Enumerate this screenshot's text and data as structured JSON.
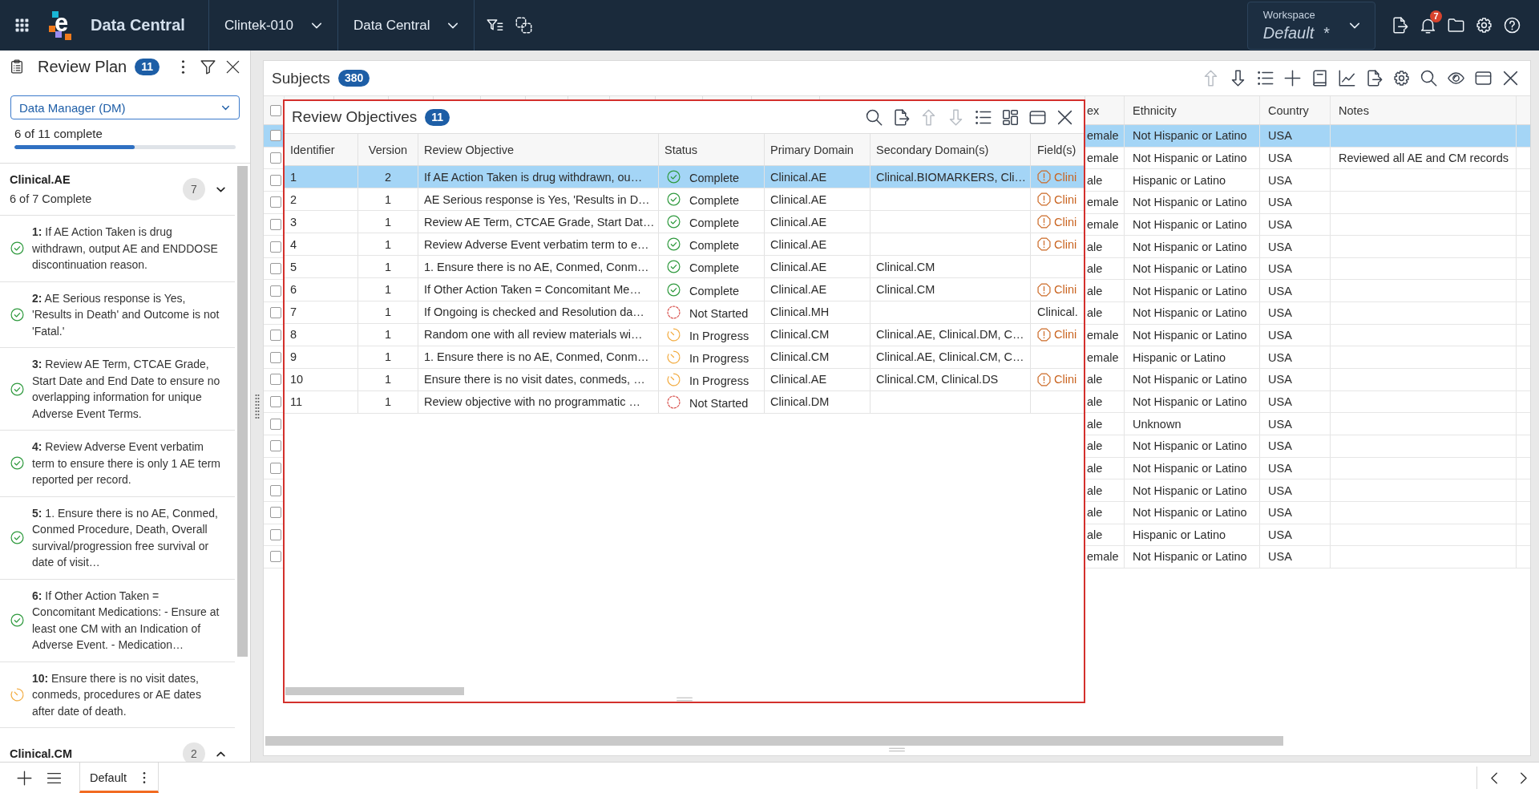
{
  "top_bar": {
    "logo_letter": "e",
    "app_name": "Data Central",
    "selectors": [
      {
        "label": "Clintek-010"
      },
      {
        "label": "Data Central"
      }
    ],
    "workspace": {
      "label": "Workspace",
      "name": "Default",
      "modified_mark": "*"
    },
    "notification_count": "7"
  },
  "review_plan": {
    "title": "Review Plan",
    "count": "11",
    "role": "Data Manager (DM)",
    "progress": {
      "text": "6 of 11 complete",
      "level": 0.545
    },
    "groups": [
      {
        "name": "Clinical.AE",
        "summary": "6 of 7 Complete",
        "count": "7",
        "expanded": true,
        "items": [
          {
            "text": "**1:** If AE Action Taken is drug withdrawn, output AE and ENDDOSE discontinuation reason.",
            "kind": "complete"
          },
          {
            "text": "**2:** AE Serious response is Yes, 'Results in Death' and Outcome is not 'Fatal.'",
            "kind": "complete"
          },
          {
            "text": "**3:** Review AE Term, CTCAE Grade, Start Date and End Date to ensure no overlapping information for unique Adverse Event Terms.",
            "kind": "complete"
          },
          {
            "text": "**4:** Review Adverse Event verbatim term to ensure there is only 1 AE term reported per record.",
            "kind": "complete"
          },
          {
            "text": "**5:** 1. Ensure there is no AE, Conmed, Conmed Procedure, Death, Overall survival/progression free survival or date of visit…",
            "kind": "complete"
          },
          {
            "text": "**6:** If Other Action Taken = Concomitant Medications: - Ensure at least one CM with an Indication of Adverse Event. - Medication…",
            "kind": "complete"
          },
          {
            "text": "**10:** Ensure there is no visit dates, conmeds, procedures or AE dates after date of death.",
            "kind": "in_progress"
          }
        ]
      },
      {
        "name": "Clinical.CM",
        "count": "2",
        "expanded": false
      }
    ]
  },
  "subjects": {
    "title": "Subjects",
    "count": "380",
    "move_up_disabled": true,
    "move_down_disabled": false,
    "header_checked": false,
    "columns": [
      "ex",
      "Ethnicity",
      "Country",
      "Notes"
    ],
    "rows": [
      {
        "selected": true,
        "checked": false,
        "column_1": "emale",
        "ethnicity": "Not Hispanic or Latino",
        "country": "USA"
      },
      {
        "selected": false,
        "checked": false,
        "column_1": "emale",
        "ethnicity": "Not Hispanic or Latino",
        "country": "USA",
        "notes": "Reviewed all AE and CM records"
      },
      {
        "selected": false,
        "checked": false,
        "column_1": "ale",
        "ethnicity": "Hispanic or Latino",
        "country": "USA"
      },
      {
        "selected": false,
        "checked": false,
        "column_1": "emale",
        "ethnicity": "Not Hispanic or Latino",
        "country": "USA"
      },
      {
        "selected": false,
        "checked": false,
        "column_1": "emale",
        "ethnicity": "Not Hispanic or Latino",
        "country": "USA"
      },
      {
        "selected": false,
        "checked": false,
        "column_1": "ale",
        "ethnicity": "Not Hispanic or Latino",
        "country": "USA"
      },
      {
        "selected": false,
        "checked": false,
        "column_1": "ale",
        "ethnicity": "Not Hispanic or Latino",
        "country": "USA"
      },
      {
        "selected": false,
        "checked": false,
        "column_1": "ale",
        "ethnicity": "Not Hispanic or Latino",
        "country": "USA"
      },
      {
        "selected": false,
        "checked": false,
        "column_1": "ale",
        "ethnicity": "Not Hispanic or Latino",
        "country": "USA"
      },
      {
        "selected": false,
        "checked": false,
        "column_1": "emale",
        "ethnicity": "Not Hispanic or Latino",
        "country": "USA"
      },
      {
        "selected": false,
        "checked": false,
        "column_1": "emale",
        "ethnicity": "Hispanic or Latino",
        "country": "USA"
      },
      {
        "selected": false,
        "checked": false,
        "column_1": "ale",
        "ethnicity": "Not Hispanic or Latino",
        "country": "USA"
      },
      {
        "selected": false,
        "checked": false,
        "column_1": "ale",
        "ethnicity": "Not Hispanic or Latino",
        "country": "USA"
      },
      {
        "selected": false,
        "checked": false,
        "column_1": "ale",
        "ethnicity": "Unknown",
        "country": "USA"
      },
      {
        "selected": false,
        "checked": false,
        "column_1": "ale",
        "ethnicity": "Not Hispanic or Latino",
        "country": "USA"
      },
      {
        "selected": false,
        "checked": false,
        "column_1": "ale",
        "ethnicity": "Not Hispanic or Latino",
        "country": "USA"
      },
      {
        "selected": false,
        "checked": false,
        "column_1": "ale",
        "ethnicity": "Not Hispanic or Latino",
        "country": "USA"
      },
      {
        "selected": false,
        "checked": false,
        "column_1": "ale",
        "ethnicity": "Not Hispanic or Latino",
        "country": "USA"
      },
      {
        "selected": false,
        "checked": false,
        "column_1": "ale",
        "ethnicity": "Hispanic or Latino",
        "country": "USA"
      },
      {
        "selected": false,
        "checked": false,
        "column_1": "emale",
        "ethnicity": "Not Hispanic or Latino",
        "country": "USA"
      }
    ]
  },
  "review_objectives": {
    "title": "Review Objectives",
    "count": "11",
    "move_up_disabled": true,
    "move_down_disabled": true,
    "columns": [
      "Identifier",
      "Version",
      "Review Objective",
      "Status",
      "Primary Domain",
      "Secondary Domain(s)",
      "Field(s)"
    ],
    "rows": [
      {
        "selected": true,
        "identifier": "1",
        "version": "2",
        "objective": "If AE Action Taken is drug withdrawn, ou…",
        "kind": "complete",
        "status": "Complete",
        "primary_domain": "Clinical.AE",
        "secondary_domains": "Clinical.BIOMARKERS, Cli…",
        "field": "Clini",
        "field_warning": true
      },
      {
        "selected": false,
        "identifier": "2",
        "version": "1",
        "objective": "AE Serious response is Yes, 'Results in D…",
        "kind": "complete",
        "status": "Complete",
        "primary_domain": "Clinical.AE",
        "field": "Clini",
        "field_warning": true
      },
      {
        "selected": false,
        "identifier": "3",
        "version": "1",
        "objective": "Review AE Term, CTCAE Grade, Start Dat…",
        "kind": "complete",
        "status": "Complete",
        "primary_domain": "Clinical.AE",
        "field": "Clini",
        "field_warning": true
      },
      {
        "selected": false,
        "identifier": "4",
        "version": "1",
        "objective": "Review Adverse Event verbatim term to e…",
        "kind": "complete",
        "status": "Complete",
        "primary_domain": "Clinical.AE",
        "field": "Clini",
        "field_warning": true
      },
      {
        "selected": false,
        "identifier": "5",
        "version": "1",
        "objective": "1. Ensure there is no AE, Conmed, Conm…",
        "kind": "complete",
        "status": "Complete",
        "primary_domain": "Clinical.AE",
        "secondary_domains": "Clinical.CM"
      },
      {
        "selected": false,
        "identifier": "6",
        "version": "1",
        "objective": "If Other Action Taken = Concomitant Me…",
        "kind": "complete",
        "status": "Complete",
        "primary_domain": "Clinical.AE",
        "secondary_domains": "Clinical.CM",
        "field": "Clini",
        "field_warning": true
      },
      {
        "selected": false,
        "identifier": "7",
        "version": "1",
        "objective": "If Ongoing is checked and Resolution da…",
        "kind": "not_started",
        "status": "Not Started",
        "primary_domain": "Clinical.MH",
        "field": "Clinical.",
        "field_warning": false
      },
      {
        "selected": false,
        "identifier": "8",
        "version": "1",
        "objective": "Random one with all review materials wi…",
        "kind": "in_progress",
        "status": "In Progress",
        "primary_domain": "Clinical.CM",
        "secondary_domains": "Clinical.AE, Clinical.DM, C…",
        "field": "Clini",
        "field_warning": true
      },
      {
        "selected": false,
        "identifier": "9",
        "version": "1",
        "objective": "1. Ensure there is no AE, Conmed, Conm…",
        "kind": "in_progress",
        "status": "In Progress",
        "primary_domain": "Clinical.CM",
        "secondary_domains": "Clinical.AE, Clinical.CM, C…"
      },
      {
        "selected": false,
        "identifier": "10",
        "version": "1",
        "objective": "Ensure there is no visit dates, conmeds, …",
        "kind": "in_progress",
        "status": "In Progress",
        "primary_domain": "Clinical.AE",
        "secondary_domains": "Clinical.CM, Clinical.DS",
        "field": "Clini",
        "field_warning": true
      },
      {
        "selected": false,
        "identifier": "11",
        "version": "1",
        "objective": "Review objective with no programmatic …",
        "kind": "not_started",
        "status": "Not Started",
        "primary_domain": "Clinical.DM"
      }
    ]
  },
  "bottom_bar": {
    "tabs": [
      {
        "label": "Default",
        "selected": true
      }
    ]
  }
}
